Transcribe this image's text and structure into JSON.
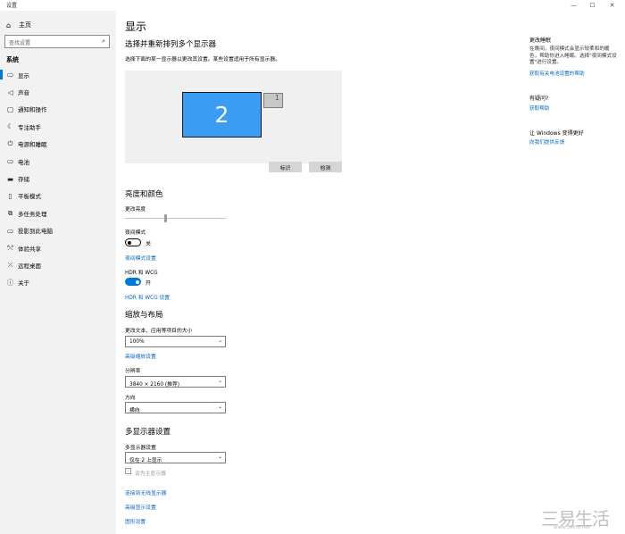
{
  "window": {
    "title": "设置",
    "minimize": "—",
    "maximize": "☐",
    "close": "✕"
  },
  "sidebar": {
    "home": "主页",
    "search_placeholder": "查找设置",
    "section": "系统",
    "items": [
      {
        "label": "显示",
        "icon": "display-icon",
        "glyph": "▭",
        "active": true
      },
      {
        "label": "声音",
        "icon": "speaker-icon",
        "glyph": "◁"
      },
      {
        "label": "通知和操作",
        "icon": "notification-icon",
        "glyph": "▢"
      },
      {
        "label": "专注助手",
        "icon": "moon-icon",
        "glyph": "☾"
      },
      {
        "label": "电源和睡眠",
        "icon": "power-icon",
        "glyph": "⏻"
      },
      {
        "label": "电池",
        "icon": "battery-icon",
        "glyph": "▭"
      },
      {
        "label": "存储",
        "icon": "storage-icon",
        "glyph": "▬"
      },
      {
        "label": "平板模式",
        "icon": "tablet-icon",
        "glyph": "▯"
      },
      {
        "label": "多任务处理",
        "icon": "multitask-icon",
        "glyph": "⧉"
      },
      {
        "label": "投影到此电脑",
        "icon": "project-icon",
        "glyph": "▭"
      },
      {
        "label": "体验共享",
        "icon": "share-icon",
        "glyph": "⤲"
      },
      {
        "label": "远程桌面",
        "icon": "remote-icon",
        "glyph": "⤬"
      },
      {
        "label": "关于",
        "icon": "info-icon",
        "glyph": "ⓘ"
      }
    ]
  },
  "main": {
    "title": "显示",
    "arrange_heading": "选择并重新排列多个显示器",
    "arrange_desc": "选择下面的某一显示器以更改其设置。某些设置适用于所有显示器。",
    "monitor_big": "2",
    "monitor_small": "1",
    "identify": "标识",
    "detect": "检测",
    "brightness_heading": "亮度和颜色",
    "brightness_label": "更改亮度",
    "brightness_value": 0.4,
    "night_label": "夜间模式",
    "night_state": "关",
    "night_link": "夜间模式设置",
    "hdr_label": "HDR 和 WCG",
    "hdr_state": "开",
    "hdr_link": "HDR 和 WCG 设置",
    "scale_heading": "缩放与布局",
    "scale_label": "更改文本、应用等项目的大小",
    "scale_value": "100%",
    "adv_scale_link": "高级缩放设置",
    "res_label": "分辨率",
    "res_value": "3840 × 2160 (推荐)",
    "orient_label": "方向",
    "orient_value": "横向",
    "multi_heading": "多显示器设置",
    "multi_label": "多显示器设置",
    "multi_value": "仅在 2 上显示",
    "main_display_label": "设为主显示器",
    "wireless_link": "连接到无线显示器",
    "adv_display_link": "高级显示设置",
    "graphics_link": "图形设置"
  },
  "right": {
    "sleep_heading": "更改睡眠",
    "sleep_text": "在晚间，夜间模式会显示较柔和的暖色，帮助你进入睡眠。选择\"夜间模式设置\"进行设置。",
    "sleep_link": "获取有关电池设置的帮助",
    "question_heading": "有疑问?",
    "help_link": "获取帮助",
    "better_heading": "让 Windows 变得更好",
    "feedback_link": "向我们提供反馈"
  },
  "watermark": {
    "text": "三易生活",
    "url": "www.3elife.net"
  },
  "colors": {
    "accent": "#0078d7",
    "monitor_selected": "#3a9cf2",
    "link": "#0067c0"
  }
}
